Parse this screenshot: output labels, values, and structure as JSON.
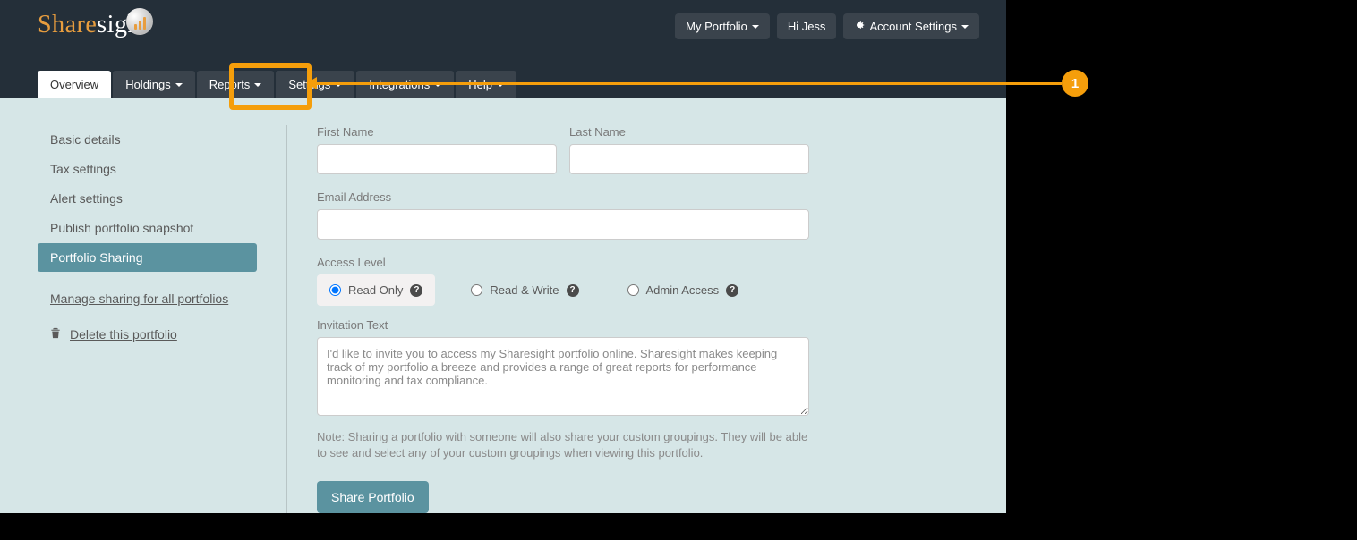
{
  "logo": {
    "share": "Share",
    "sight": "sight"
  },
  "topButtons": {
    "myPortfolio": "My Portfolio",
    "greeting": "Hi Jess",
    "accountSettings": "Account Settings"
  },
  "nav": {
    "overview": "Overview",
    "holdings": "Holdings",
    "reports": "Reports",
    "settings": "Settings",
    "integrations": "Integrations",
    "help": "Help"
  },
  "sidebar": {
    "basic": "Basic details",
    "tax": "Tax settings",
    "alert": "Alert settings",
    "publish": "Publish portfolio snapshot",
    "sharing": "Portfolio Sharing",
    "manageAll": "Manage sharing for all portfolios",
    "delete": "Delete this portfolio"
  },
  "form": {
    "firstName": "First Name",
    "lastName": "Last Name",
    "email": "Email Address",
    "accessLevel": "Access Level",
    "readOnly": "Read Only",
    "readWrite": "Read & Write",
    "admin": "Admin Access",
    "invitationLabel": "Invitation Text",
    "invitationText": "I'd like to invite you to access my Sharesight portfolio online. Sharesight makes keeping track of my portfolio a breeze and provides a range of great reports for performance monitoring and tax compliance.",
    "note": "Note: Sharing a portfolio with someone will also share your custom groupings. They will be able to see and select any of your custom groupings when viewing this portfolio.",
    "shareButton": "Share Portfolio"
  },
  "annotation": {
    "number": "1"
  }
}
